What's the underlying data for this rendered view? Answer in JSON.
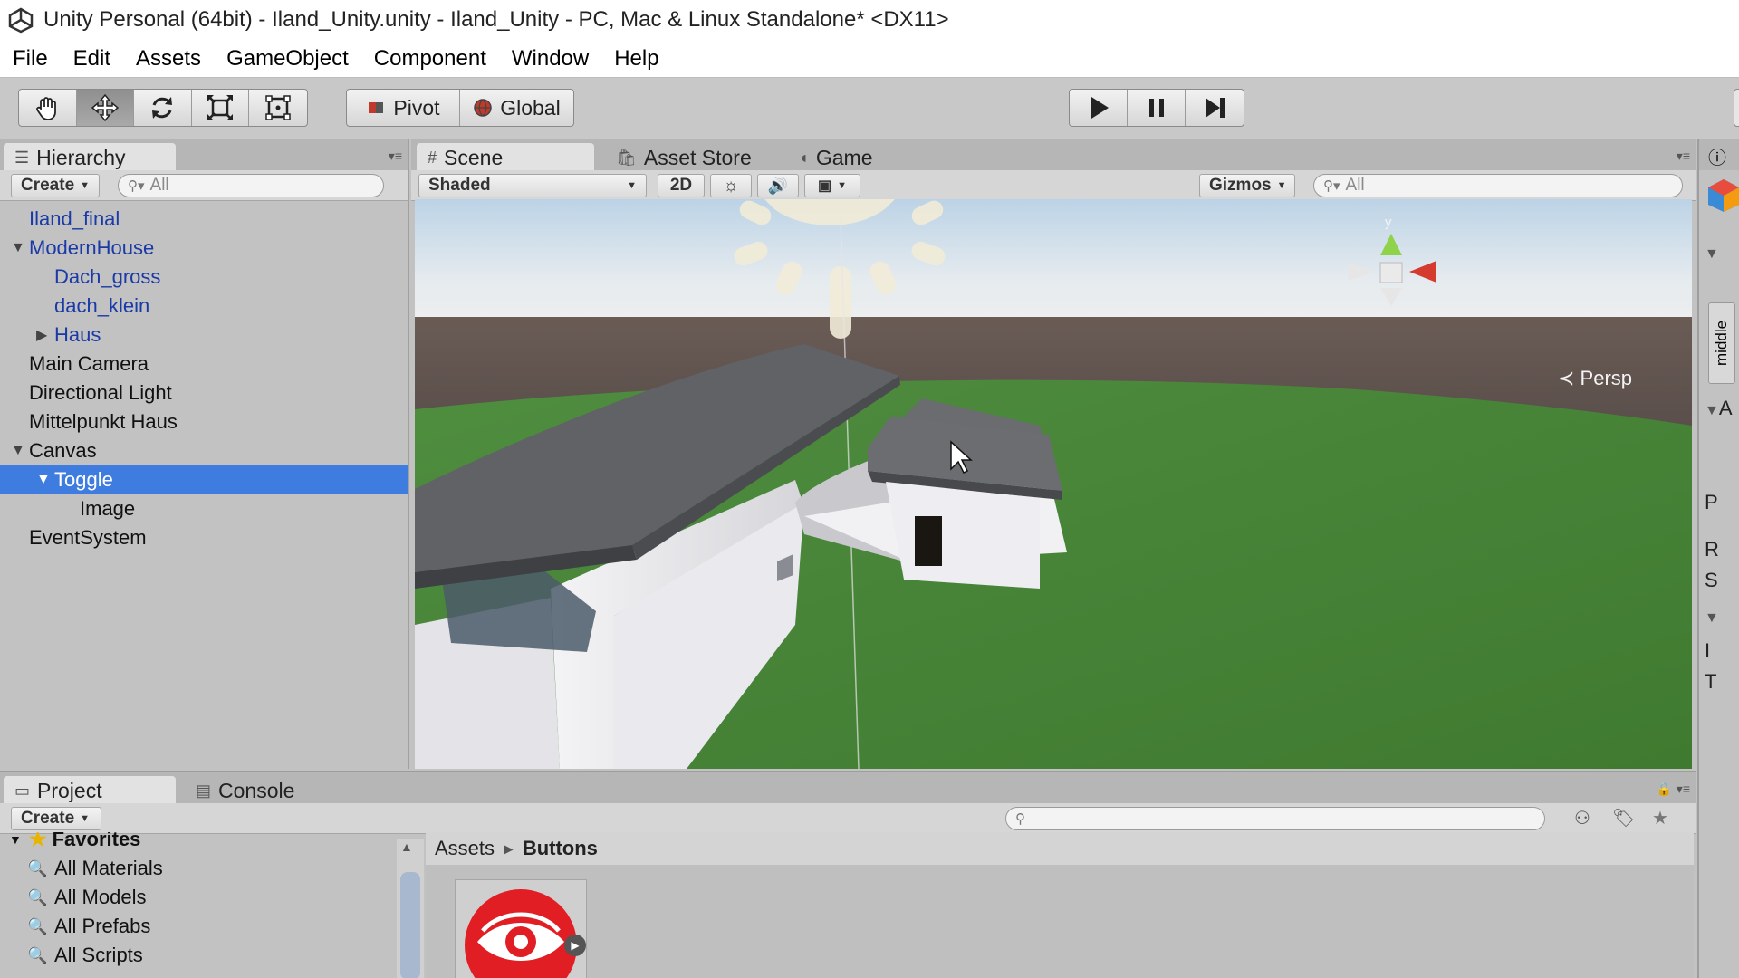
{
  "window": {
    "title": "Unity Personal (64bit) - Iland_Unity.unity - Iland_Unity - PC, Mac & Linux Standalone* <DX11>"
  },
  "menu": [
    "File",
    "Edit",
    "Assets",
    "GameObject",
    "Component",
    "Window",
    "Help"
  ],
  "toolbar": {
    "tools": [
      "hand-tool",
      "move-tool",
      "rotate-tool",
      "scale-tool",
      "rect-tool"
    ],
    "pivot_label": "Pivot",
    "global_label": "Global",
    "play": [
      "play",
      "pause",
      "step"
    ]
  },
  "hierarchy": {
    "tab": "Hierarchy",
    "create": "Create",
    "search_placeholder": "All",
    "items": [
      {
        "label": "Iland_final",
        "indent": 0,
        "blue": true,
        "arrow": ""
      },
      {
        "label": "ModernHouse",
        "indent": 0,
        "blue": true,
        "arrow": "down"
      },
      {
        "label": "Dach_gross",
        "indent": 1,
        "blue": true,
        "arrow": ""
      },
      {
        "label": "dach_klein",
        "indent": 1,
        "blue": true,
        "arrow": ""
      },
      {
        "label": "Haus",
        "indent": 1,
        "blue": true,
        "arrow": "right"
      },
      {
        "label": "Main Camera",
        "indent": 0,
        "blue": false,
        "arrow": ""
      },
      {
        "label": "Directional Light",
        "indent": 0,
        "blue": false,
        "arrow": ""
      },
      {
        "label": "Mittelpunkt Haus",
        "indent": 0,
        "blue": false,
        "arrow": ""
      },
      {
        "label": "Canvas",
        "indent": 0,
        "blue": false,
        "arrow": "down"
      },
      {
        "label": "Toggle",
        "indent": 1,
        "blue": false,
        "arrow": "down",
        "selected": true
      },
      {
        "label": "Image",
        "indent": 2,
        "blue": false,
        "arrow": ""
      },
      {
        "label": "EventSystem",
        "indent": 0,
        "blue": false,
        "arrow": ""
      }
    ]
  },
  "scene": {
    "tabs": [
      "Scene",
      "Asset Store",
      "Game"
    ],
    "shading": "Shaded",
    "mode_2d": "2D",
    "gizmos": "Gizmos",
    "search_placeholder": "All",
    "persp_label": "Persp",
    "gizmo_y_label": "y"
  },
  "inspector": {
    "sliver_labels": [
      "middle",
      "A",
      "P",
      "R",
      "S",
      "I",
      "T"
    ]
  },
  "project": {
    "tabs": [
      "Project",
      "Console"
    ],
    "create": "Create",
    "favorites_label": "Favorites",
    "favorites": [
      "All Materials",
      "All Models",
      "All Prefabs",
      "All Scripts"
    ],
    "breadcrumb": [
      "Assets",
      "Buttons"
    ]
  },
  "colors": {
    "selection": "#3e7ce0",
    "prefab_blue": "#1a3aa8",
    "panel": "#c2c2c2"
  }
}
